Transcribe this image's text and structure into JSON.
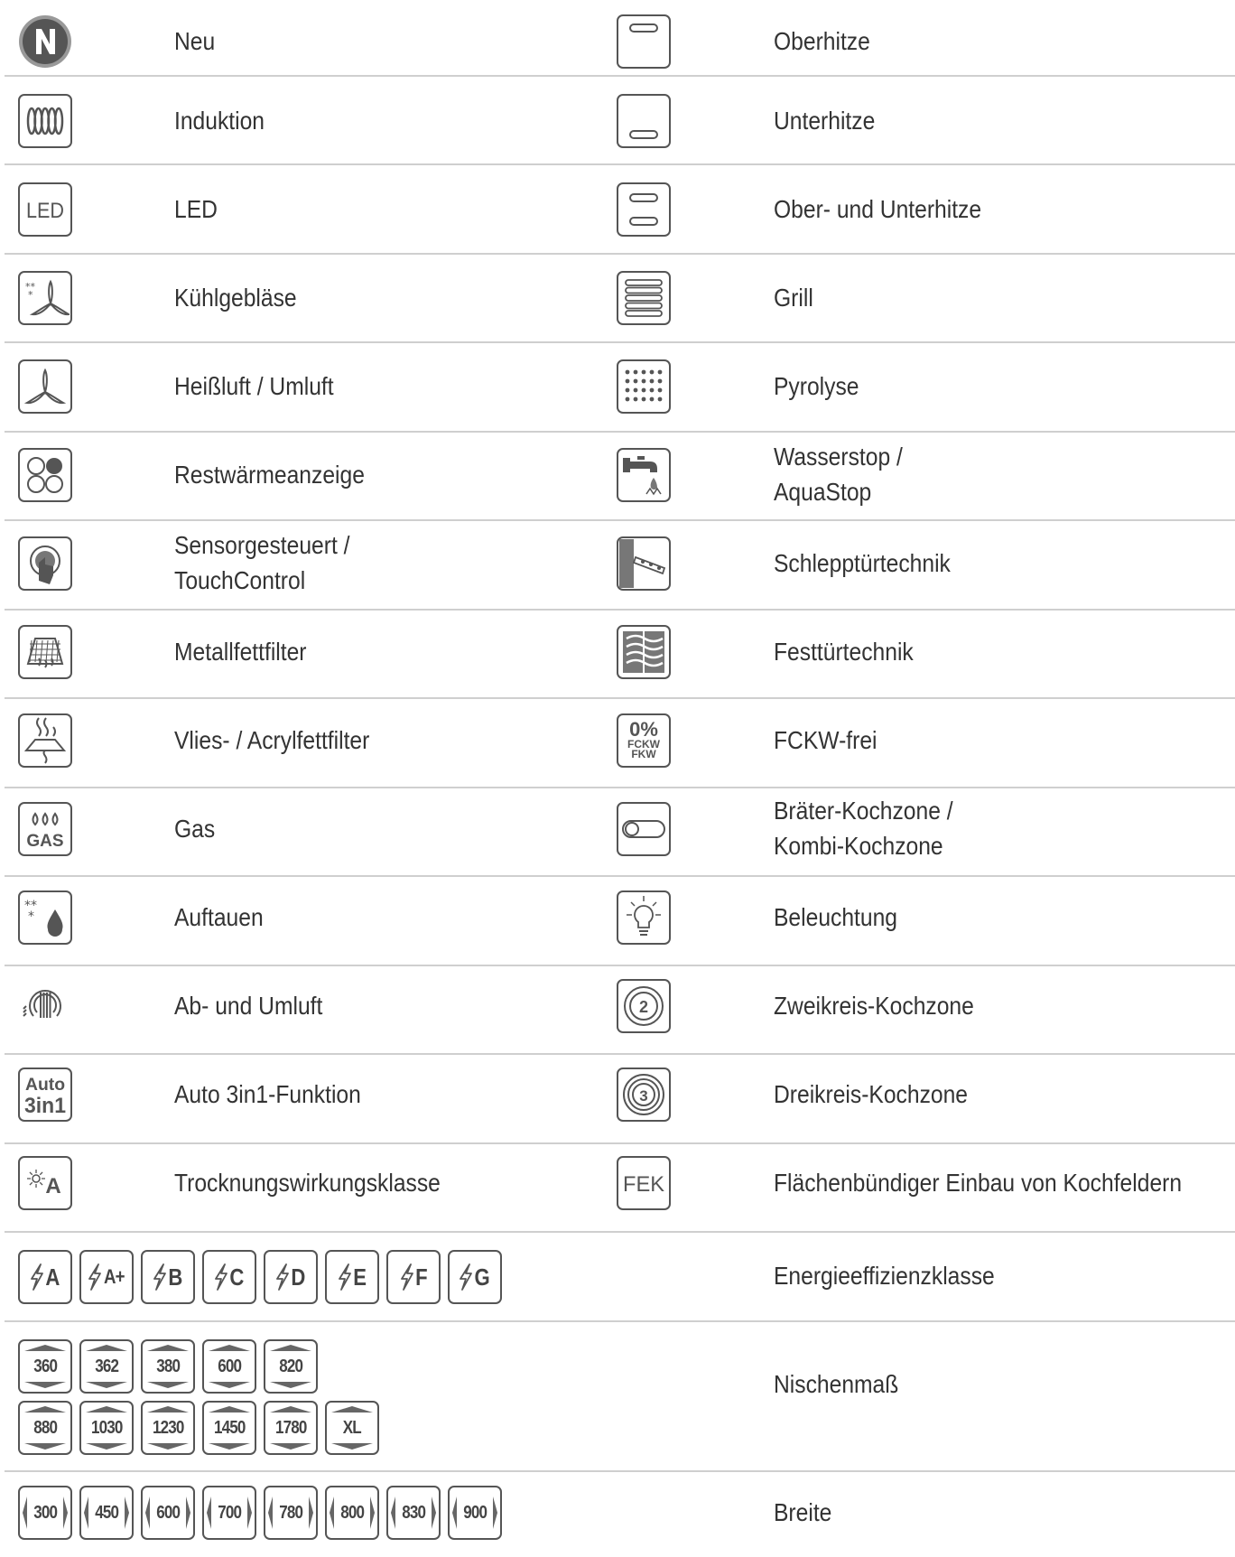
{
  "left_column": [
    {
      "icon": "new-n-icon",
      "label": "Neu"
    },
    {
      "icon": "induction-coil-icon",
      "label": "Induktion"
    },
    {
      "icon": "led-icon",
      "label": "LED"
    },
    {
      "icon": "cooling-fan-icon",
      "label": "Kühlgebläse"
    },
    {
      "icon": "hot-air-fan-icon",
      "label": "Heißluft / Umluft"
    },
    {
      "icon": "residual-heat-icon",
      "label": "Restwärmeanzeige"
    },
    {
      "icon": "touch-control-icon",
      "label_line1": "Sensorgesteuert /",
      "label_line2": "TouchControl"
    },
    {
      "icon": "metal-grease-filter-icon",
      "label": "Metallfettfilter"
    },
    {
      "icon": "fleece-acrylic-filter-icon",
      "label": "Vlies- / Acrylfettfilter"
    },
    {
      "icon": "gas-flame-icon",
      "label": "Gas",
      "icon_text": "GAS"
    },
    {
      "icon": "defrost-icon",
      "label": "Auftauen"
    },
    {
      "icon": "exhaust-recirculation-icon",
      "label": "Ab- und Umluft"
    },
    {
      "icon": "auto-3in1-icon",
      "label": "Auto 3in1-Funktion",
      "icon_text_1": "Auto",
      "icon_text_2": "3in1"
    },
    {
      "icon": "drying-class-icon",
      "label": "Trocknungswirkungsklasse",
      "icon_text": "A"
    }
  ],
  "right_column": [
    {
      "icon": "top-heat-icon",
      "label": "Oberhitze"
    },
    {
      "icon": "bottom-heat-icon",
      "label": "Unterhitze"
    },
    {
      "icon": "top-bottom-heat-icon",
      "label": "Ober- und Unterhitze"
    },
    {
      "icon": "grill-icon",
      "label": "Grill"
    },
    {
      "icon": "pyrolysis-icon",
      "label": "Pyrolyse"
    },
    {
      "icon": "aquastop-faucet-icon",
      "label_line1": "Wasserstop /",
      "label_line2": "AquaStop"
    },
    {
      "icon": "sliding-hinge-door-icon",
      "label": "Schlepptürtechnik"
    },
    {
      "icon": "fixed-door-icon",
      "label": "Festtürtechnik"
    },
    {
      "icon": "cfc-free-icon",
      "label": "FCKW-frei",
      "icon_text_1": "0%",
      "icon_text_2": "FCKW",
      "icon_text_3": "FKW"
    },
    {
      "icon": "roaster-zone-icon",
      "label_line1": "Bräter-Kochzone /",
      "label_line2": "Kombi-Kochzone"
    },
    {
      "icon": "lighting-bulb-icon",
      "label": "Beleuchtung"
    },
    {
      "icon": "dual-zone-icon",
      "label": "Zweikreis-Kochzone",
      "icon_text": "2"
    },
    {
      "icon": "triple-zone-icon",
      "label": "Dreikreis-Kochzone",
      "icon_text": "3"
    },
    {
      "icon": "fek-icon",
      "label": "Flächenbündiger Einbau von Kochfeldern",
      "icon_text": "FEK"
    }
  ],
  "energy": {
    "label": "Energieeffizienzklasse",
    "classes": [
      "A",
      "A+",
      "B",
      "C",
      "D",
      "E",
      "F",
      "G"
    ]
  },
  "niche": {
    "label": "Nischenmaß",
    "row1": [
      "360",
      "362",
      "380",
      "600",
      "820"
    ],
    "row2": [
      "880",
      "1030",
      "1230",
      "1450",
      "1780",
      "XL"
    ]
  },
  "width": {
    "label": "Breite",
    "values": [
      "300",
      "450",
      "600",
      "700",
      "780",
      "800",
      "830",
      "900"
    ]
  }
}
